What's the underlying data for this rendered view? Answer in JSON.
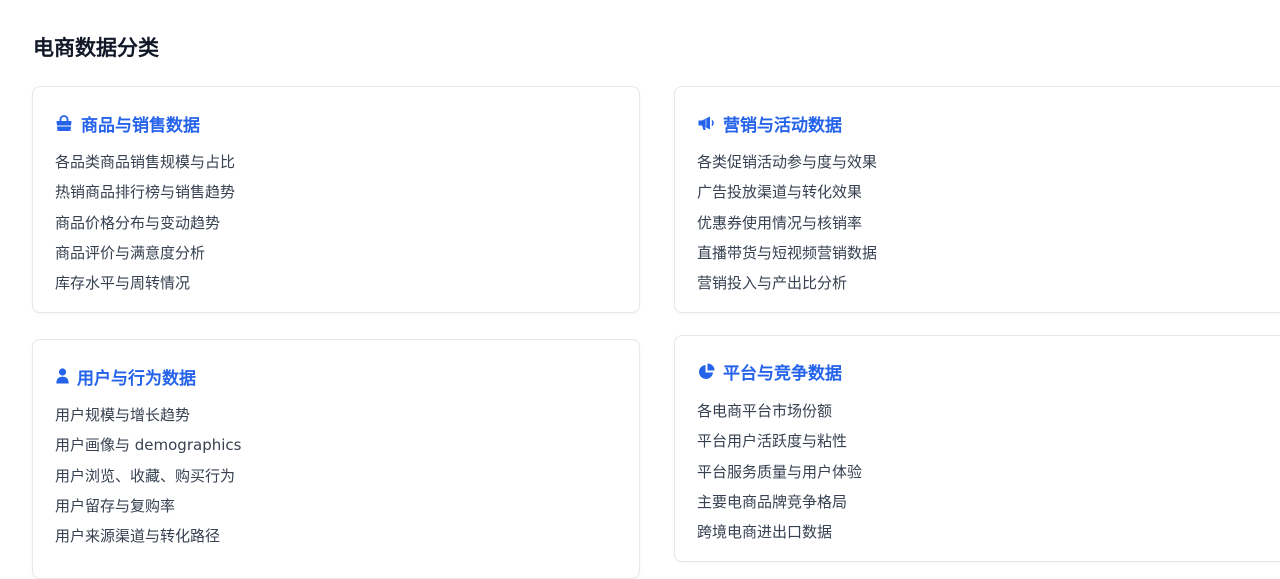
{
  "page": {
    "title": "电商数据分类"
  },
  "colors": {
    "accent": "#2563eb",
    "text": "#374151",
    "border": "#e5e7eb"
  },
  "cards": [
    {
      "icon": "shopping-bag-icon",
      "title": "商品与销售数据",
      "items": [
        "各品类商品销售规模与占比",
        "热销商品排行榜与销售趋势",
        "商品价格分布与变动趋势",
        "商品评价与满意度分析",
        "库存水平与周转情况"
      ]
    },
    {
      "icon": "bullhorn-icon",
      "title": "营销与活动数据",
      "items": [
        "各类促销活动参与度与效果",
        "广告投放渠道与转化效果",
        "优惠券使用情况与核销率",
        "直播带货与短视频营销数据",
        "营销投入与产出比分析"
      ]
    },
    {
      "icon": "user-icon",
      "title": "用户与行为数据",
      "items": [
        "用户规模与增长趋势",
        "用户画像与 demographics",
        "用户浏览、收藏、购买行为",
        "用户留存与复购率",
        "用户来源渠道与转化路径"
      ]
    },
    {
      "icon": "pie-chart-icon",
      "title": "平台与竞争数据",
      "items": [
        "各电商平台市场份额",
        "平台用户活跃度与粘性",
        "平台服务质量与用户体验",
        "主要电商品牌竞争格局",
        "跨境电商进出口数据"
      ]
    }
  ]
}
